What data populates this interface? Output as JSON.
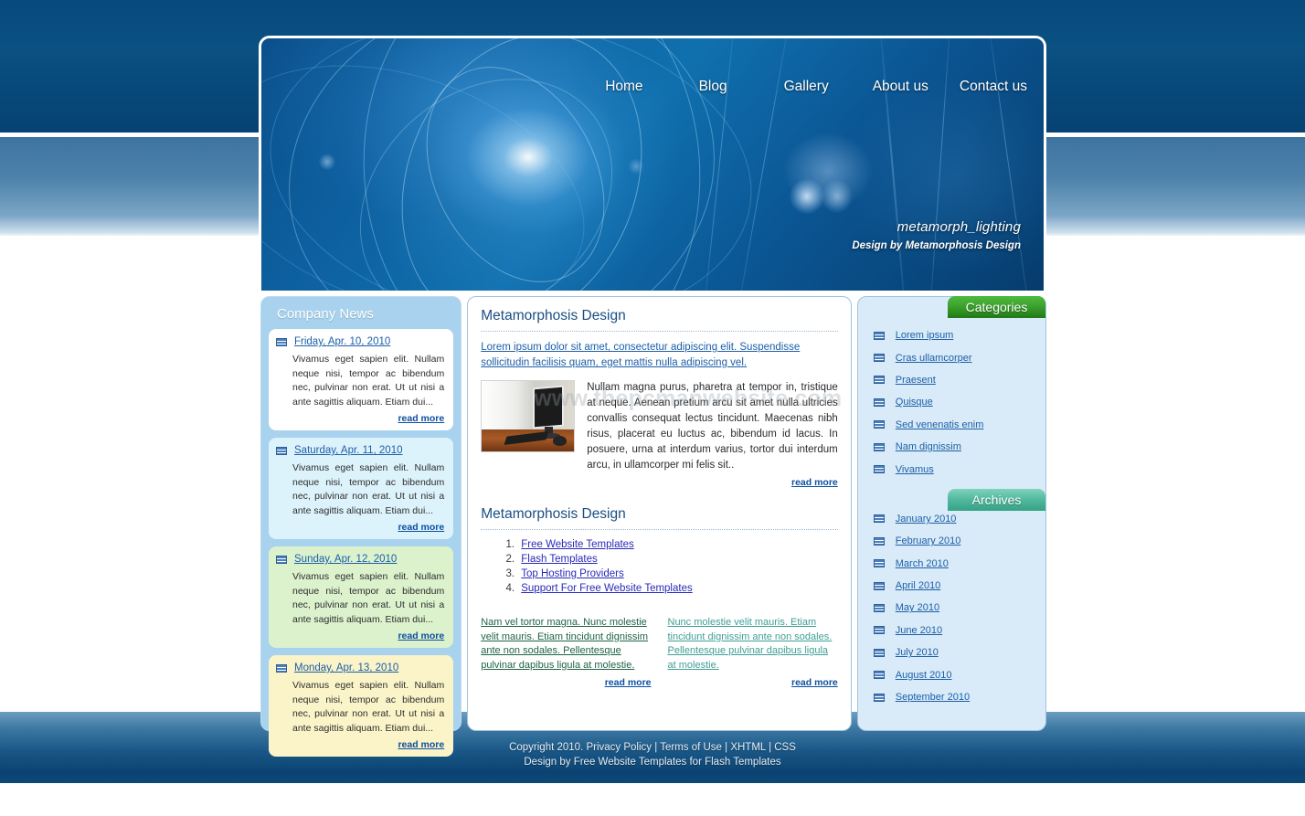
{
  "site": {
    "brand_title": "metamorph_lighting",
    "brand_subtitle": "Design by Metamorphosis Design",
    "watermark": "www.thepcmanwebsite.com",
    "accent_blue": "#0a5182",
    "accent_green": "#3ba02c",
    "accent_teal": "#52b99f",
    "link_blue": "#1d5fa8"
  },
  "nav": {
    "items": [
      {
        "label": "Home"
      },
      {
        "label": "Blog"
      },
      {
        "label": "Gallery"
      },
      {
        "label": "About us"
      },
      {
        "label": "Contact us"
      }
    ]
  },
  "sidebar_left": {
    "title": "Company News",
    "items": [
      {
        "date": "Friday, Apr. 10, 2010",
        "text": "Vivamus eget sapien elit. Nullam neque nisi, tempor ac bibendum nec, pulvinar non erat. Ut ut nisi a ante sagittis aliquam. Etiam dui...",
        "read_more": "read more",
        "icon": "list-bullet-icon"
      },
      {
        "date": "Saturday, Apr. 11, 2010",
        "text": "Vivamus eget sapien elit. Nullam neque nisi, tempor ac bibendum nec, pulvinar non erat. Ut ut nisi a ante sagittis aliquam. Etiam dui...",
        "read_more": "read more",
        "icon": "list-bullet-icon"
      },
      {
        "date": "Sunday, Apr. 12, 2010",
        "text": "Vivamus eget sapien elit. Nullam neque nisi, tempor ac bibendum nec, pulvinar non erat. Ut ut nisi a ante sagittis aliquam. Etiam dui...",
        "read_more": "read more",
        "icon": "list-bullet-icon"
      },
      {
        "date": "Monday, Apr. 13, 2010",
        "text": "Vivamus eget sapien elit. Nullam neque nisi, tempor ac bibendum nec, pulvinar non erat. Ut ut nisi a ante sagittis aliquam. Etiam dui...",
        "read_more": "read more",
        "icon": "list-bullet-icon"
      }
    ]
  },
  "main": {
    "section1": {
      "heading": "Metamorphosis Design",
      "lead": "Lorem ipsum dolor sit amet, consectetur adipiscing elit. Suspendisse sollicitudin facilisis quam, eget mattis nulla adipiscing vel.",
      "body": "Nullam magna purus, pharetra at tempor in, tristique at neque. Aenean pretium arcu sit amet nulla ultricies convallis consequat lectus tincidunt. Maecenas nibh risus, placerat eu luctus ac, bibendum id lacus. In posuere, urna at interdum varius, tortor dui interdum arcu, in ullamcorper mi felis sit..",
      "read_more": "read more",
      "image_alt": "desktop-computer-photo"
    },
    "section2": {
      "heading": "Metamorphosis Design",
      "list": [
        {
          "label": "Free Website Templates"
        },
        {
          "label": "Flash Templates"
        },
        {
          "label": "Top Hosting Providers"
        },
        {
          "label": "Support For Free Website Templates"
        }
      ]
    },
    "section3": {
      "left_text": "Nam vel tortor magna. Nunc molestie velit mauris. Etiam tincidunt dignissim ante non sodales. Pellentesque pulvinar dapibus ligula at molestie.",
      "left_read_more": "read more",
      "right_text": "Nunc molestie velit mauris. Etiam tincidunt dignissim ante non sodales. Pellentesque pulvinar dapibus ligula at molestie.",
      "right_read_more": "read more"
    }
  },
  "sidebar_right": {
    "categories": {
      "title": "Categories",
      "items": [
        {
          "label": "Lorem ipsum"
        },
        {
          "label": "Cras ullamcorper"
        },
        {
          "label": "Praesent"
        },
        {
          "label": "Quisque"
        },
        {
          "label": "Sed venenatis enim"
        },
        {
          "label": "Nam dignissim"
        },
        {
          "label": "Vivamus"
        }
      ]
    },
    "archives": {
      "title": "Archives",
      "items": [
        {
          "label": "January 2010"
        },
        {
          "label": "February 2010"
        },
        {
          "label": "March 2010"
        },
        {
          "label": "April 2010"
        },
        {
          "label": "May 2010"
        },
        {
          "label": "June 2010"
        },
        {
          "label": "July 2010"
        },
        {
          "label": "August 2010"
        },
        {
          "label": "September 2010"
        }
      ]
    }
  },
  "footer": {
    "line1": "Copyright 2010. Privacy Policy | Terms of Use | XHTML | CSS",
    "line2": "Design by Free Website Templates for Flash Templates"
  }
}
